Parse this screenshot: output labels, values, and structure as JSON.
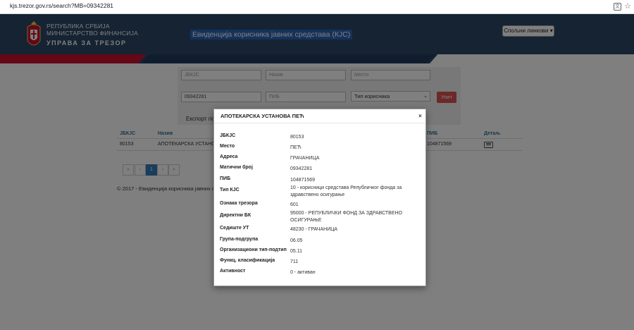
{
  "browser": {
    "url": "kjs.trezor.gov.rs/search?MB=09342281"
  },
  "header": {
    "org_line1": "РЕПУБЛИКА СРБИЈА",
    "org_line2": "МИНИСТАРСТВО ФИНАНСИЈА",
    "org_line3": "УПРАВА ЗА ТРЕЗОР",
    "app_title": "Евиденција корисника јавних средстава (КЈС)",
    "links_button": "Спољни линкови",
    "colors": {
      "navy": "#2a4766",
      "red": "#c8102e",
      "blue": "#2d65b8"
    }
  },
  "filters": {
    "jbkjc_placeholder": "ЈБКЈС",
    "name_placeholder": "Назив",
    "place_placeholder": "Место",
    "mb_value": "09342281",
    "pib_placeholder": "ПИБ",
    "user_type_selected": "Тип корисника",
    "search_button": "Упит"
  },
  "results": {
    "export_label": "Експорт под",
    "headers": {
      "jbkjc": "ЈБКЈС",
      "name": "Назив",
      "pib": "ПИБ",
      "detail": "Детаљ"
    },
    "rows": [
      {
        "jbkjc": "80153",
        "name": "АПОТЕКАРСКА УСТАНОВ",
        "pib": "104871569"
      }
    ]
  },
  "pagination": {
    "first": "«",
    "prev": "‹",
    "current": "1",
    "next": "›",
    "last": "»"
  },
  "footer": {
    "text": "© 2017 - Евиденција корисника јавних сре"
  },
  "modal": {
    "title": "АПОТЕКАРСКА УСТАНОВА ПЕЋ",
    "close": "×",
    "fields": [
      {
        "label": "ЈБКЈС",
        "value": "80153"
      },
      {
        "label": "Место",
        "value": "ПЕЋ"
      },
      {
        "label": "Адреса",
        "value": "ГРАЧАНИЦА"
      },
      {
        "label": "Матични број",
        "value": "09342281"
      },
      {
        "label": "ПИБ",
        "value": "104871569"
      },
      {
        "label": "Тип КЈС",
        "value": "10 - корисници средстава Републичког фонда за здравствено осигурање"
      },
      {
        "label": "Ознака трезора",
        "value": "601"
      },
      {
        "label": "Директни БК",
        "value": "95000 - РЕПУБЛИЧКИ ФОНД ЗА ЗДРАВСТВЕНО ОСИГУРАЊЕ"
      },
      {
        "label": "Седиште УТ",
        "value": "48230 - ГРАЧАНИЦА"
      },
      {
        "label": "Група-подгрупа",
        "value": "06.05"
      },
      {
        "label": "Организациони тип-подтип",
        "value": "05.11"
      },
      {
        "label": "Функц. класификација",
        "value": "711"
      },
      {
        "label": "Активност",
        "value": "0 - активан"
      }
    ]
  }
}
